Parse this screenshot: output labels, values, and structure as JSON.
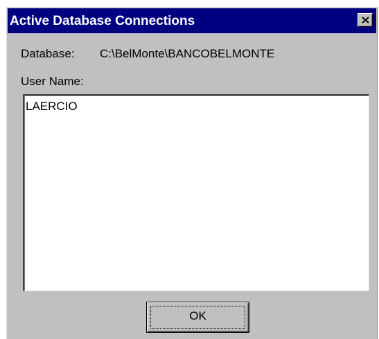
{
  "window": {
    "title": "Active Database Connections",
    "close_icon": "close-x-icon"
  },
  "database": {
    "label": "Database:",
    "value": "C:\\BelMonte\\BANCOBELMONTE"
  },
  "users": {
    "label": "User Name:",
    "items": [
      "LAERCIO"
    ]
  },
  "buttons": {
    "ok_label": "OK"
  },
  "colors": {
    "titlebar": "#000080",
    "face": "#c0c0c0"
  }
}
